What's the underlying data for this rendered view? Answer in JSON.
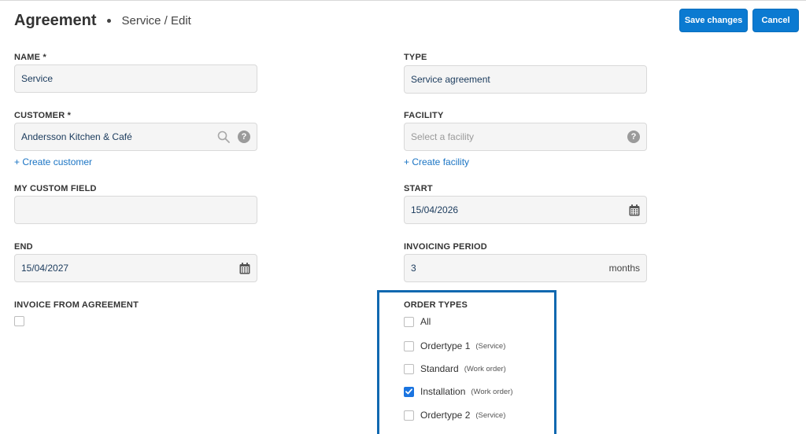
{
  "header": {
    "title": "Agreement",
    "breadcrumb": "Service / Edit",
    "save_label": "Save changes",
    "cancel_label": "Cancel"
  },
  "form": {
    "name": {
      "label": "NAME *",
      "value": "Service"
    },
    "type": {
      "label": "TYPE",
      "value": "Service agreement"
    },
    "customer": {
      "label": "CUSTOMER *",
      "value": "Andersson Kitchen & Café",
      "create_link": "+ Create customer"
    },
    "facility": {
      "label": "FACILITY",
      "placeholder": "Select a facility",
      "create_link": "+ Create facility"
    },
    "custom_field": {
      "label": "MY CUSTOM FIELD",
      "value": ""
    },
    "start": {
      "label": "START",
      "value": "15/04/2026"
    },
    "end": {
      "label": "END",
      "value": "15/04/2027"
    },
    "invoicing_period": {
      "label": "INVOICING PERIOD",
      "value": "3",
      "unit": "months"
    },
    "invoice_from_agreement": {
      "label": "INVOICE FROM AGREEMENT",
      "checked": false
    }
  },
  "order_types": {
    "label": "ORDER TYPES",
    "items": [
      {
        "name": "All",
        "sub": "",
        "checked": false
      },
      {
        "name": "Ordertype 1",
        "sub": "(Service)",
        "checked": false
      },
      {
        "name": "Standard",
        "sub": "(Work order)",
        "checked": false
      },
      {
        "name": "Installation",
        "sub": "(Work order)",
        "checked": true
      },
      {
        "name": "Ordertype 2",
        "sub": "(Service)",
        "checked": false
      }
    ]
  },
  "icons": {
    "search": "search-icon",
    "help": "help-icon",
    "calendar": "calendar-icon",
    "checkmark": "checkmark-icon"
  },
  "colors": {
    "primary": "#0b7ad1",
    "link": "#1a74c4",
    "highlight_border": "#1068b0",
    "checkbox_checked": "#1a74e0"
  }
}
